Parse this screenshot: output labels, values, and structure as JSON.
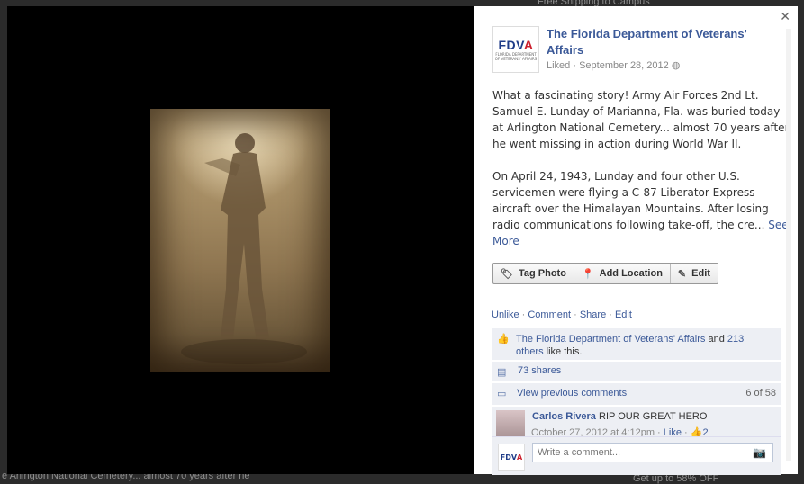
{
  "background": {
    "top_right_text": "Free Shipping to Campus",
    "bottom_left_text": "e Arlington National Cemetery... almost 70 years after he",
    "bottom_right_text": "Get up to 58% OFF"
  },
  "post": {
    "page_name": "The Florida Department of Veterans' Affairs",
    "logo_text_a": "FDV",
    "logo_text_b": "A",
    "logo_subtext": "FLORIDA DEPARTMENT OF VETERANS' AFFAIRS",
    "liked_label": "Liked",
    "date": "September 28, 2012",
    "paragraph_1": "What a fascinating story! Army Air Forces 2nd Lt. Samuel E. Lunday of Marianna, Fla. was buried today at Arlington National Cemetery... almost 70 years after he went missing in action during World War II.",
    "paragraph_2": "On April 24, 1943, Lunday and four other U.S. servicemen were flying a C-87 Liberator Express aircraft over the Himalayan Mountains. After losing radio communications following take-off, the cre...",
    "see_more": "See More"
  },
  "actions": {
    "tag_photo": "Tag Photo",
    "add_location": "Add Location",
    "edit": "Edit"
  },
  "links": {
    "unlike": "Unlike",
    "comment": "Comment",
    "share": "Share",
    "edit": "Edit"
  },
  "ufi": {
    "likes_page": "The Florida Department of Veterans' Affairs",
    "likes_and": "and",
    "likes_others": "213 others",
    "likes_suffix": "like this.",
    "shares": "73 shares",
    "view_previous": "View previous comments",
    "comment_count": "6 of 58"
  },
  "comment": {
    "author": "Carlos Rivera",
    "text": "RIP OUR GREAT HERO",
    "time": "October 27, 2012 at 4:12pm",
    "like": "Like",
    "like_count": "2"
  },
  "composer": {
    "placeholder": "Write a comment...",
    "mini_logo_a": "FDV",
    "mini_logo_b": "A"
  }
}
